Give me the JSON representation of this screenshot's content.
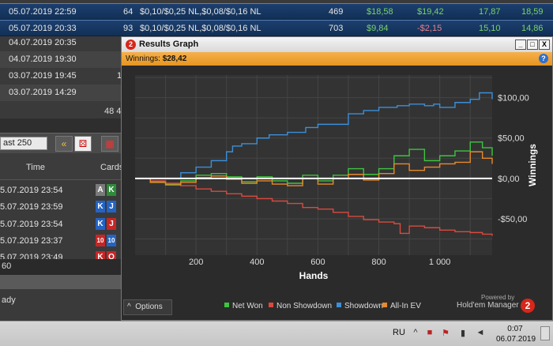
{
  "sessions": {
    "rows": [
      {
        "date": "05.07.2019 22:59",
        "tables": "64",
        "stakes": "$0,10/$0,25 NL,$0,08/$0,16 NL",
        "hands": "469",
        "won": "$18,58",
        "ev": "$19,42",
        "bb": "17,87",
        "bbev": "18,59"
      },
      {
        "date": "05.07.2019 20:33",
        "tables": "93",
        "stakes": "$0,10/$0,25 NL,$0,08/$0,16 NL",
        "hands": "703",
        "won": "$9,84",
        "ev": "-$2,15",
        "bb": "15,10",
        "bbev": "14,86"
      },
      {
        "date": "04.07.2019 20:35"
      },
      {
        "date": "04.07.2019 19:30"
      },
      {
        "date": "03.07.2019 19:45",
        "tables": "1"
      },
      {
        "date": "03.07.2019 14:29"
      }
    ],
    "footer_partial": "48 4"
  },
  "toolbar": {
    "filter_value": "ast 250",
    "rewind_icon": "double-chevron-left-icon",
    "dice_icon": "dice-icon",
    "grid_icon": "color-grid-icon"
  },
  "hands": {
    "col_time": "Time",
    "col_cards": "Cards",
    "rows": [
      {
        "time": "5.07.2019 23:54",
        "c1": "A",
        "c2": "K"
      },
      {
        "time": "5.07.2019 23:59",
        "c1": "K",
        "c2": "J"
      },
      {
        "time": "5.07.2019 23:54",
        "c1": "K",
        "c2": "J"
      },
      {
        "time": "5.07.2019 23:37",
        "c1": "10",
        "c2": "10"
      },
      {
        "time": "5.07.2019 23:49",
        "c1": "K",
        "c2": "Q"
      }
    ],
    "count_partial": "60",
    "status_partial": "ady"
  },
  "window": {
    "title": "Results Graph",
    "logo_text": "2",
    "minimize": "_",
    "maximize": "□",
    "close": "X",
    "winnings_label": "Winnings:",
    "winnings_value": "$28,42",
    "help": "?",
    "options": "Options",
    "options_arrow": "^",
    "powered_by": "Powered by",
    "brand": "Hold'em Manager",
    "brand_logo": "2"
  },
  "chart_data": {
    "type": "line",
    "xlabel": "Hands",
    "ylabel": "Winnings",
    "xlim": [
      0,
      1172
    ],
    "ylim": [
      -95,
      128
    ],
    "x_ticks": [
      200,
      400,
      600,
      800,
      1000
    ],
    "x_tick_labels": [
      "200",
      "400",
      "600",
      "800",
      "1 000"
    ],
    "y_ticks": [
      100,
      50,
      0,
      -50
    ],
    "y_tick_labels": [
      "$100,00",
      "$50,00",
      "$0,00",
      "-$50,00"
    ],
    "grid": true,
    "legend_position": "bottom",
    "colors": {
      "net_won": "#3ec43e",
      "non_showdown": "#d94a3e",
      "showdown": "#3b8fd9",
      "all_in_ev": "#e8892b",
      "zero_line": "#ffffff"
    },
    "series": [
      {
        "name": "Net Won",
        "color": "#3ec43e",
        "x": [
          0,
          50,
          100,
          150,
          200,
          250,
          300,
          350,
          400,
          450,
          500,
          550,
          600,
          650,
          700,
          750,
          800,
          850,
          900,
          950,
          1000,
          1050,
          1100,
          1140,
          1172
        ],
        "y": [
          0,
          -4,
          -7,
          -3,
          4,
          6,
          2,
          -4,
          2,
          -3,
          -6,
          4,
          -3,
          4,
          12,
          5,
          12,
          28,
          36,
          22,
          28,
          34,
          45,
          38,
          28
        ]
      },
      {
        "name": "Non Showdown",
        "color": "#d94a3e",
        "x": [
          0,
          50,
          100,
          150,
          200,
          250,
          300,
          350,
          400,
          450,
          500,
          550,
          600,
          650,
          700,
          750,
          800,
          850,
          870,
          900,
          950,
          1000,
          1050,
          1100,
          1140,
          1172
        ],
        "y": [
          0,
          -3,
          -6,
          -9,
          -13,
          -16,
          -19,
          -22,
          -25,
          -28,
          -31,
          -36,
          -38,
          -42,
          -47,
          -51,
          -54,
          -56,
          -68,
          -59,
          -61,
          -64,
          -66,
          -67,
          -69,
          -71
        ]
      },
      {
        "name": "Showdown",
        "color": "#3b8fd9",
        "x": [
          0,
          70,
          150,
          200,
          250,
          300,
          320,
          350,
          400,
          440,
          500,
          560,
          600,
          650,
          700,
          750,
          800,
          860,
          900,
          950,
          980,
          1000,
          1050,
          1100,
          1130,
          1150,
          1172
        ],
        "y": [
          0,
          0,
          7,
          14,
          22,
          33,
          40,
          43,
          50,
          54,
          57,
          63,
          67,
          67,
          80,
          84,
          88,
          90,
          92,
          90,
          92,
          88,
          94,
          98,
          106,
          106,
          98
        ]
      },
      {
        "name": "All-In EV",
        "color": "#e8892b",
        "x": [
          0,
          50,
          100,
          150,
          200,
          250,
          300,
          350,
          400,
          450,
          500,
          550,
          600,
          650,
          700,
          750,
          800,
          850,
          900,
          950,
          1000,
          1050,
          1100,
          1140,
          1172
        ],
        "y": [
          0,
          -5,
          -8,
          -5,
          1,
          3,
          -1,
          -6,
          -3,
          -7,
          -9,
          0,
          -7,
          0,
          5,
          -2,
          6,
          18,
          10,
          14,
          18,
          20,
          33,
          25,
          18
        ]
      }
    ]
  },
  "taskbar": {
    "lang": "RU",
    "up_arrow_icon": "^",
    "time": "0:07",
    "date": "06.07.2019"
  }
}
